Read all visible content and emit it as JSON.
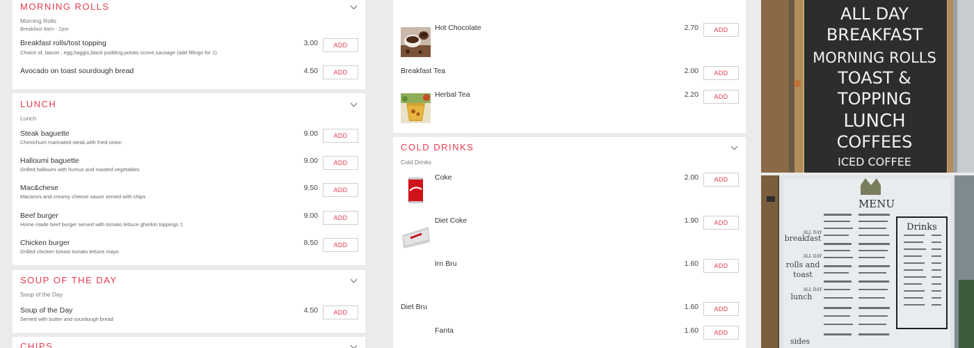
{
  "left_menu": {
    "morning": {
      "title": "Morning Rolls",
      "subtitle": "Morning Rolls",
      "hours": "Breakfast 8am - 2pm",
      "items": [
        {
          "name": "Breakfast rolls/tost topping",
          "desc": "Choice of, bacon , egg,haggis,black pudding,potato scone,sausage (add fillings for 1)",
          "price": "3.00"
        },
        {
          "name": "Avocado on toast sourdough bread",
          "desc": "",
          "price": "4.50"
        }
      ]
    },
    "lunch": {
      "title": "Lunch",
      "subtitle": "Lunch",
      "items": [
        {
          "name": "Steak baguette",
          "desc": "Chimichurri marinated steak,with fried onion",
          "price": "9.00"
        },
        {
          "name": "Halloumi baguette",
          "desc": "Grilled halloumi with humus and roasted vegetables",
          "price": "9.00"
        },
        {
          "name": "Mac&chese",
          "desc": "Macaroni and creamy cheese sauce served with chips",
          "price": "9.50"
        },
        {
          "name": "Beef burger",
          "desc": "Home made beef burger served with tomato lettuce gherkin toppings 1",
          "price": "9.00"
        },
        {
          "name": "Chicken burger",
          "desc": "Grilled chicken breast tomato lettuce mayo",
          "price": "8.50"
        }
      ]
    },
    "soup": {
      "title": "Soup of the Day",
      "subtitle": "Soup of the Day",
      "items": [
        {
          "name": "Soup of the Day",
          "desc": "Served with butter and sourdough bread",
          "price": "4.50"
        }
      ]
    },
    "chips": {
      "title": "Chips"
    }
  },
  "right_menu": {
    "hot_items": [
      {
        "name": "Hot Chocolate",
        "price": "2.70",
        "thumb": "hot-chocolate-photo"
      },
      {
        "name": "Breakfast Tea",
        "price": "2.00"
      },
      {
        "name": "Herbal Tea",
        "price": "2.20",
        "thumb": "herbal-tea-photo"
      }
    ],
    "cold": {
      "title": "Cold Drinks",
      "subtitle": "Cold Drinks",
      "items": [
        {
          "name": "Coke",
          "price": "2.00",
          "thumb": "coke-can-photo"
        },
        {
          "name": "Diet Coke",
          "price": "1.90",
          "thumb": "diet-coke-can-photo"
        },
        {
          "name": "Irn Bru",
          "price": "1.60"
        },
        {
          "name": "Diet Bru",
          "price": "1.60"
        },
        {
          "name": "Fanta",
          "price": "1.60"
        }
      ]
    }
  },
  "add_label": "ADD",
  "photos": {
    "chalkboard": {
      "lines": [
        "ALL DAY",
        "BREAKFAST",
        "MORNING ROLLS",
        "TOAST &",
        "TOPPING",
        "LUNCH",
        "COFFEES",
        "ICED COFFEE"
      ]
    },
    "menu_board": {
      "heading": "MENU",
      "drinks_heading": "Drinks",
      "side_words": [
        "ALL DAY",
        "breakfast",
        "ALL DAY",
        "rolls and",
        "toast",
        "ALL DAY",
        "lunch",
        "sides"
      ]
    }
  },
  "colors": {
    "accent": "#e23b4e",
    "background": "#ebebeb",
    "panel": "#ffffff"
  }
}
